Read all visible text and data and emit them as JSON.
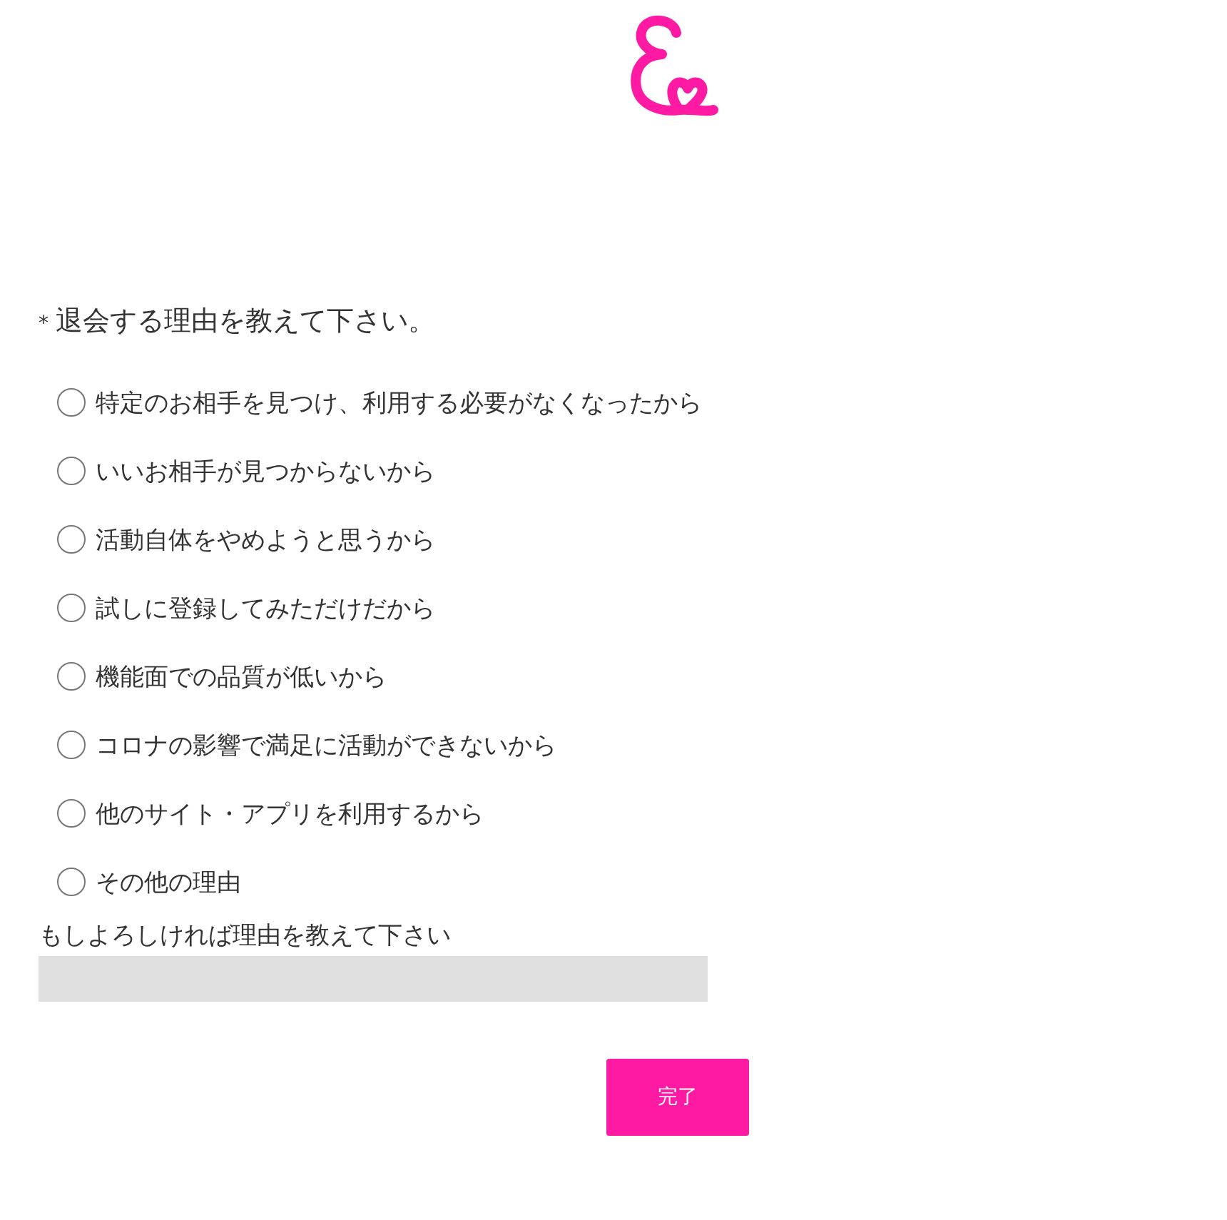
{
  "question": {
    "required_mark": "*",
    "text": "退会する理由を教えて下さい。"
  },
  "options": [
    {
      "label": "特定のお相手を見つけ、利用する必要がなくなったから",
      "selected": false
    },
    {
      "label": "いいお相手が見つからないから",
      "selected": false
    },
    {
      "label": "活動自体をやめようと思うから",
      "selected": false
    },
    {
      "label": "試しに登録してみただけだから",
      "selected": false
    },
    {
      "label": "機能面での品質が低いから",
      "selected": false
    },
    {
      "label": "コロナの影響で満足に活動ができないから",
      "selected": false
    },
    {
      "label": "他のサイト・アプリを利用するから",
      "selected": false
    },
    {
      "label": "その他の理由",
      "selected": false
    }
  ],
  "comment": {
    "label": "もしよろしければ理由を教えて下さい"
  },
  "submit_button": "完了"
}
